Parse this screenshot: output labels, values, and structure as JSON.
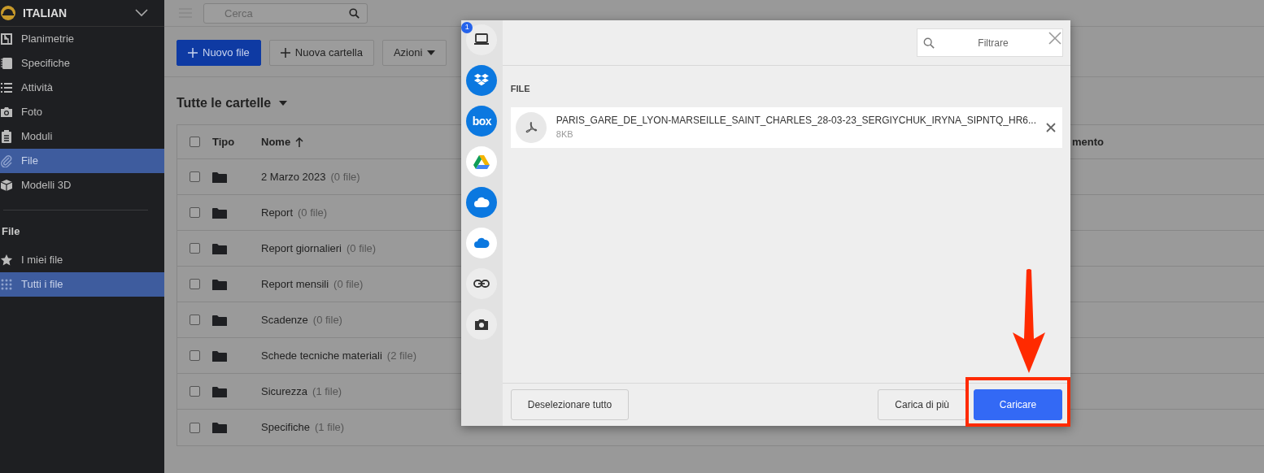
{
  "sidebar": {
    "project": "ITALIAN",
    "items": [
      {
        "kind": "plans",
        "label": "Planimetrie",
        "selected": false
      },
      {
        "kind": "specs",
        "label": "Specifiche",
        "selected": false
      },
      {
        "kind": "tasks",
        "label": "Attività",
        "selected": false
      },
      {
        "kind": "photo",
        "label": "Foto",
        "selected": false
      },
      {
        "kind": "forms",
        "label": "Moduli",
        "selected": false
      },
      {
        "kind": "files",
        "label": "File",
        "selected": true
      },
      {
        "kind": "models",
        "label": "Modelli 3D",
        "selected": false
      }
    ],
    "section_title": "File",
    "section_items": [
      {
        "kind": "star",
        "label": "I miei file",
        "selected": false
      },
      {
        "kind": "grid",
        "label": "Tutti i file",
        "selected": true
      }
    ]
  },
  "topbar": {
    "search": {
      "placeholder": "Cerca"
    }
  },
  "toolbar": {
    "buttons": [
      {
        "kind": "primary",
        "label": "Nuovo file"
      },
      {
        "kind": "plus",
        "label": "Nuova cartella"
      },
      {
        "kind": "dropdown",
        "label": "Azioni"
      }
    ]
  },
  "folder_view": {
    "title": "Tutte le cartelle"
  },
  "table": {
    "select_all_checked": false,
    "columns": [
      {
        "label": "Tipo"
      },
      {
        "label": "Nome",
        "sorted": true
      },
      {
        "label": "mento"
      }
    ],
    "rows": [
      {
        "name": "2 Marzo 2023",
        "count": "(0 file)",
        "checked": false
      },
      {
        "name": "Report",
        "count": "(0 file)",
        "checked": false
      },
      {
        "name": "Report giornalieri",
        "count": "(0 file)",
        "checked": false
      },
      {
        "name": "Report mensili",
        "count": "(0 file)",
        "checked": false
      },
      {
        "name": "Scadenze",
        "count": "(0 file)",
        "checked": false
      },
      {
        "name": "Schede tecniche materiali",
        "count": "(2 file)",
        "checked": false
      },
      {
        "name": "Sicurezza",
        "count": "(1 file)",
        "checked": false
      },
      {
        "name": "Specifiche",
        "count": "(1 file)",
        "checked": false
      }
    ]
  },
  "upload_dialog": {
    "sources": [
      {
        "kind": "device",
        "badge": "1"
      },
      {
        "kind": "dropbox"
      },
      {
        "kind": "box",
        "label": "box"
      },
      {
        "kind": "drive"
      },
      {
        "kind": "cloud"
      },
      {
        "kind": "cloud-outline"
      },
      {
        "kind": "link"
      },
      {
        "kind": "camera"
      }
    ],
    "filter": {
      "placeholder": "Filtrare"
    },
    "section_label": "FILE",
    "files": [
      {
        "name": "PARIS_GARE_DE_LYON-MARSEILLE_SAINT_CHARLES_28-03-23_SERGIYCHUK_IRYNA_SIPNTQ_HR6...",
        "size": "8KB"
      }
    ],
    "buttons": [
      {
        "kind": "secondary",
        "label": "Deselezionare tutto"
      },
      {
        "kind": "secondary",
        "label": "Carica di più"
      },
      {
        "kind": "primary",
        "label": "Caricare",
        "highlighted": true
      }
    ]
  }
}
